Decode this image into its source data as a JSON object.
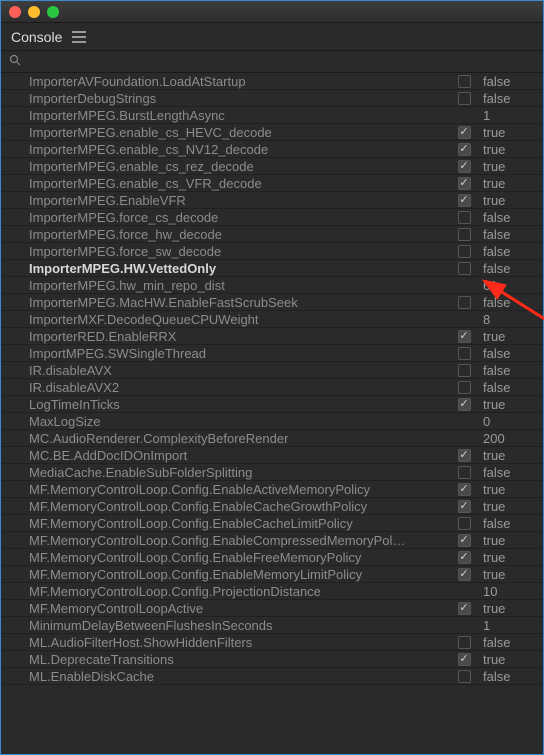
{
  "window": {
    "title": "Console"
  },
  "search": {
    "placeholder": ""
  },
  "rows": [
    {
      "name": "ImporterAVFoundation.LoadAtStartup",
      "hasCheck": true,
      "checked": false,
      "value": "false"
    },
    {
      "name": "ImporterDebugStrings",
      "hasCheck": true,
      "checked": false,
      "value": "false"
    },
    {
      "name": "ImporterMPEG.BurstLengthAsync",
      "hasCheck": false,
      "checked": false,
      "value": "1"
    },
    {
      "name": "ImporterMPEG.enable_cs_HEVC_decode",
      "hasCheck": true,
      "checked": true,
      "value": "true"
    },
    {
      "name": "ImporterMPEG.enable_cs_NV12_decode",
      "hasCheck": true,
      "checked": true,
      "value": "true"
    },
    {
      "name": "ImporterMPEG.enable_cs_rez_decode",
      "hasCheck": true,
      "checked": true,
      "value": "true"
    },
    {
      "name": "ImporterMPEG.enable_cs_VFR_decode",
      "hasCheck": true,
      "checked": true,
      "value": "true"
    },
    {
      "name": "ImporterMPEG.EnableVFR",
      "hasCheck": true,
      "checked": true,
      "value": "true"
    },
    {
      "name": "ImporterMPEG.force_cs_decode",
      "hasCheck": true,
      "checked": false,
      "value": "false"
    },
    {
      "name": "ImporterMPEG.force_hw_decode",
      "hasCheck": true,
      "checked": false,
      "value": "false"
    },
    {
      "name": "ImporterMPEG.force_sw_decode",
      "hasCheck": true,
      "checked": false,
      "value": "false"
    },
    {
      "name": "ImporterMPEG.HW.VettedOnly",
      "hasCheck": true,
      "checked": false,
      "value": "false",
      "highlight": true
    },
    {
      "name": "ImporterMPEG.hw_min_repo_dist",
      "hasCheck": false,
      "checked": false,
      "value": "61"
    },
    {
      "name": "ImporterMPEG.MacHW.EnableFastScrubSeek",
      "hasCheck": true,
      "checked": false,
      "value": "false"
    },
    {
      "name": "ImporterMXF.DecodeQueueCPUWeight",
      "hasCheck": false,
      "checked": false,
      "value": "8"
    },
    {
      "name": "ImporterRED.EnableRRX",
      "hasCheck": true,
      "checked": true,
      "value": "true"
    },
    {
      "name": "ImportMPEG.SWSingleThread",
      "hasCheck": true,
      "checked": false,
      "value": "false"
    },
    {
      "name": "IR.disableAVX",
      "hasCheck": true,
      "checked": false,
      "value": "false"
    },
    {
      "name": "IR.disableAVX2",
      "hasCheck": true,
      "checked": false,
      "value": "false"
    },
    {
      "name": "LogTimeInTicks",
      "hasCheck": true,
      "checked": true,
      "value": "true"
    },
    {
      "name": "MaxLogSize",
      "hasCheck": false,
      "checked": false,
      "value": "0"
    },
    {
      "name": "MC.AudioRenderer.ComplexityBeforeRender",
      "hasCheck": false,
      "checked": false,
      "value": "200"
    },
    {
      "name": "MC.BE.AddDocIDOnImport",
      "hasCheck": true,
      "checked": true,
      "value": "true"
    },
    {
      "name": "MediaCache.EnableSubFolderSplitting",
      "hasCheck": true,
      "checked": false,
      "value": "false"
    },
    {
      "name": "MF.MemoryControlLoop.Config.EnableActiveMemoryPolicy",
      "hasCheck": true,
      "checked": true,
      "value": "true"
    },
    {
      "name": "MF.MemoryControlLoop.Config.EnableCacheGrowthPolicy",
      "hasCheck": true,
      "checked": true,
      "value": "true"
    },
    {
      "name": "MF.MemoryControlLoop.Config.EnableCacheLimitPolicy",
      "hasCheck": true,
      "checked": false,
      "value": "false"
    },
    {
      "name": "MF.MemoryControlLoop.Config.EnableCompressedMemoryPol…",
      "hasCheck": true,
      "checked": true,
      "value": "true"
    },
    {
      "name": "MF.MemoryControlLoop.Config.EnableFreeMemoryPolicy",
      "hasCheck": true,
      "checked": true,
      "value": "true"
    },
    {
      "name": "MF.MemoryControlLoop.Config.EnableMemoryLimitPolicy",
      "hasCheck": true,
      "checked": true,
      "value": "true"
    },
    {
      "name": "MF.MemoryControlLoop.Config.ProjectionDistance",
      "hasCheck": false,
      "checked": false,
      "value": "10"
    },
    {
      "name": "MF.MemoryControlLoopActive",
      "hasCheck": true,
      "checked": true,
      "value": "true"
    },
    {
      "name": "MinimumDelayBetweenFlushesInSeconds",
      "hasCheck": false,
      "checked": false,
      "value": "1"
    },
    {
      "name": "ML.AudioFilterHost.ShowHiddenFilters",
      "hasCheck": true,
      "checked": false,
      "value": "false"
    },
    {
      "name": "ML.DeprecateTransitions",
      "hasCheck": true,
      "checked": true,
      "value": "true"
    },
    {
      "name": "ML.EnableDiskCache",
      "hasCheck": true,
      "checked": false,
      "value": "false"
    }
  ]
}
